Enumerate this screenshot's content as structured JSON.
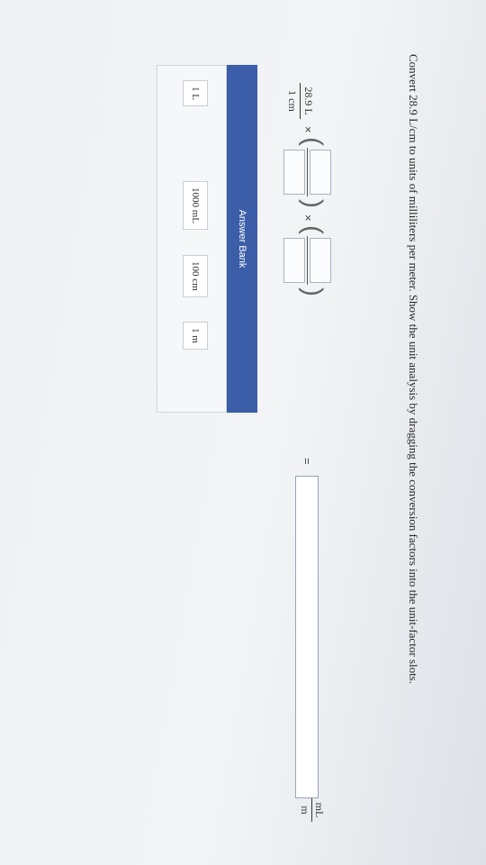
{
  "question": "Convert 28.9 L/cm to units of milliliters per meter. Show the unit analysis by dragging the conversion factors into the unit-factor slots.",
  "given": {
    "numerator": "28.9 L",
    "denominator": "1 cm"
  },
  "times_symbol": "×",
  "equals_symbol": "=",
  "open_paren": "(",
  "close_paren": ")",
  "result_unit": {
    "numerator": "mL",
    "denominator": "m"
  },
  "answer_bank": {
    "title": "Answer Bank",
    "chips": [
      "1 L",
      "1000 mL",
      "100 cm",
      "1 m"
    ]
  }
}
